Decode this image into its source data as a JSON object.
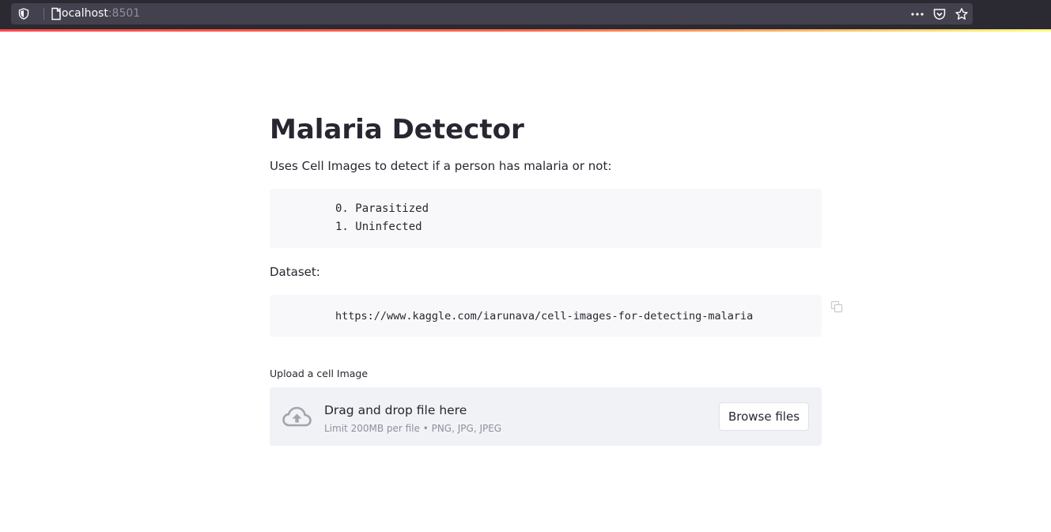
{
  "browser": {
    "url_host": "localhost",
    "url_port": ":8501"
  },
  "page": {
    "title": "Malaria Detector",
    "intro": "Uses Cell Images to detect if a person has malaria or not:",
    "classes": [
      "0. Parasitized",
      "1. Uninfected"
    ],
    "dataset_label": "Dataset:",
    "dataset_url": "https://www.kaggle.com/iarunava/cell-images-for-detecting-malaria"
  },
  "uploader": {
    "label": "Upload a cell Image",
    "drop_title": "Drag and drop file here",
    "drop_subtitle": "Limit 200MB per file • PNG, JPG, JPEG",
    "browse_label": "Browse files"
  },
  "icons": {
    "shield": "shield-icon",
    "page": "page-icon",
    "more": "more-options-icon",
    "pocket": "pocket-icon",
    "bookmark": "bookmark-star-icon",
    "copy": "copy-icon",
    "upload": "cloud-upload-icon"
  },
  "colors": {
    "accent_gradient_start": "#ff4b4b",
    "accent_gradient_end": "#fffd80",
    "code_background": "#f8f8fa",
    "dropzone_background": "#f0f2f6",
    "text": "#262730"
  }
}
